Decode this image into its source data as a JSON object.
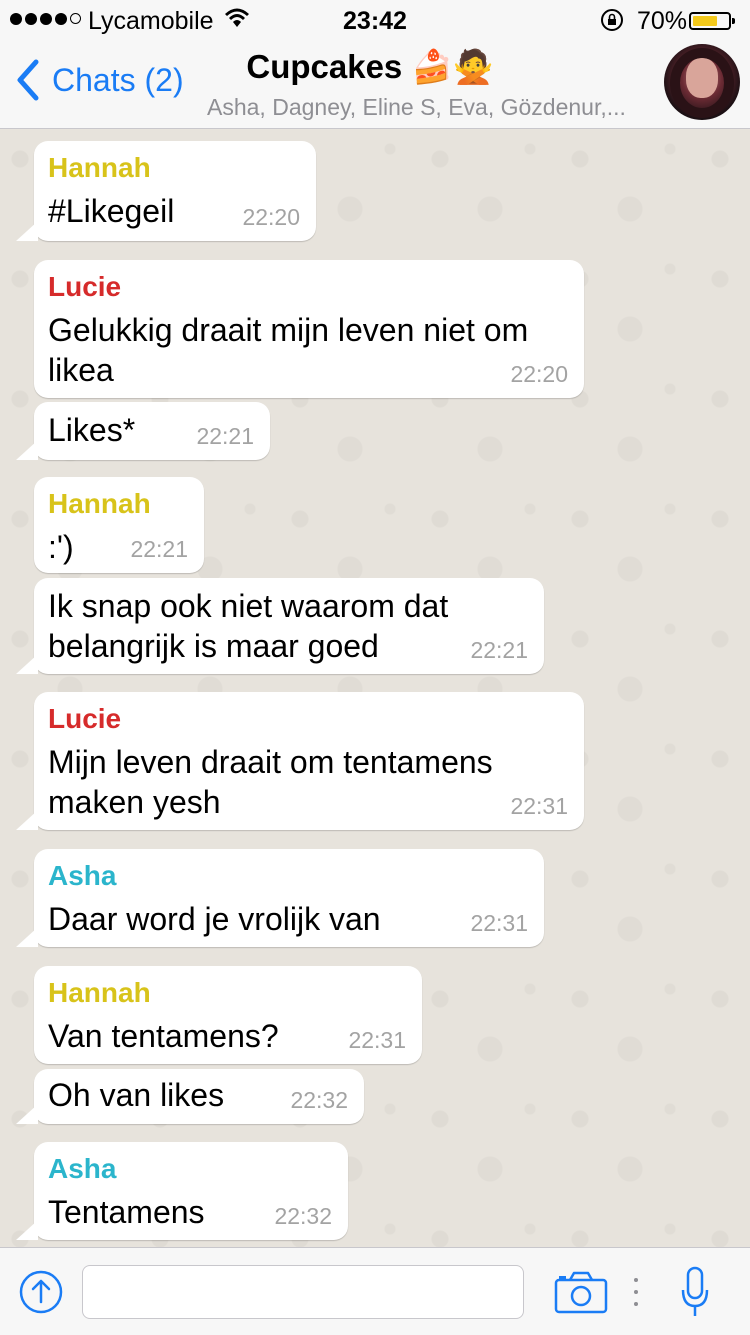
{
  "status_bar": {
    "carrier": "Lycamobile",
    "signal_bars": 4,
    "time": "23:42",
    "battery_percent": "70%",
    "battery_level": 0.7,
    "battery_color": "#f3c91b"
  },
  "nav": {
    "back_label": "Chats (2)",
    "title": "Cupcakes",
    "title_emoji": "🍰🙅",
    "subtitle": "Asha, Dagney, Eline S, Eva, Gözdenur,...",
    "accent_color": "#1a7cf5"
  },
  "sender_colors": {
    "Hannah": "#d8c31a",
    "Lucie": "#d62b2b",
    "Asha": "#2bb5cc"
  },
  "messages": [
    {
      "sender": "Hannah",
      "text": "#Likegeil",
      "time": "22:20"
    },
    {
      "sender": "Lucie",
      "text": "Gelukkig draait mijn leven niet om likea",
      "time": "22:20"
    },
    {
      "sender": "",
      "text": "Likes*",
      "time": "22:21"
    },
    {
      "sender": "Hannah",
      "text": ":')",
      "time": "22:21"
    },
    {
      "sender": "",
      "text": "Ik snap ook niet waarom dat belangrijk is maar goed",
      "time": "22:21"
    },
    {
      "sender": "Lucie",
      "text": "Mijn leven draait om tentamens maken yesh",
      "time": "22:31"
    },
    {
      "sender": "Asha",
      "text": "Daar word je vrolijk van",
      "time": "22:31"
    },
    {
      "sender": "Hannah",
      "text": "Van tentamens?",
      "time": "22:31"
    },
    {
      "sender": "",
      "text": "Oh van likes",
      "time": "22:32"
    },
    {
      "sender": "Asha",
      "text": "Tentamens",
      "time": "22:32"
    }
  ],
  "input": {
    "value": "",
    "placeholder": ""
  },
  "icons": {
    "upload": "upload-arrow-icon",
    "camera": "camera-icon",
    "more": "more-dots-icon",
    "mic": "microphone-icon"
  }
}
